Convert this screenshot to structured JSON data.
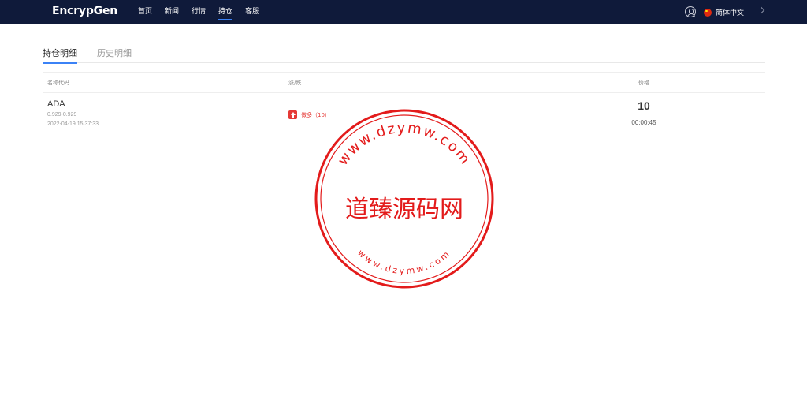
{
  "header": {
    "logo": "EncrypGen",
    "nav": [
      {
        "label": "首页",
        "active": false
      },
      {
        "label": "新闻",
        "active": false
      },
      {
        "label": "行情",
        "active": false
      },
      {
        "label": "持仓",
        "active": true
      },
      {
        "label": "客服",
        "active": false
      }
    ],
    "language": "简体中文",
    "icons": {
      "user": "user-icon",
      "flag": "china-flag-icon",
      "expand": "chevron-right-icon"
    }
  },
  "tabs": [
    {
      "label": "持仓明细",
      "active": true
    },
    {
      "label": "历史明细",
      "active": false
    }
  ],
  "table": {
    "headers": [
      "名称代码",
      "涨/跌",
      "价格"
    ],
    "rows": [
      {
        "symbol": "ADA",
        "range": "0.929-0.929",
        "time": "2022-04-19 15:37:33",
        "direction": "做多（10）",
        "price": "10",
        "countdown": "00:00:45"
      }
    ]
  },
  "watermark": {
    "center": "道臻源码网",
    "top_arc": "www.dzymw.com",
    "bottom_arc": "www.dzymw.com",
    "color": "#e31b1b"
  },
  "colors": {
    "header_bg": "#0f1a3a",
    "accent": "#3b82f6",
    "up": "#e53935"
  }
}
